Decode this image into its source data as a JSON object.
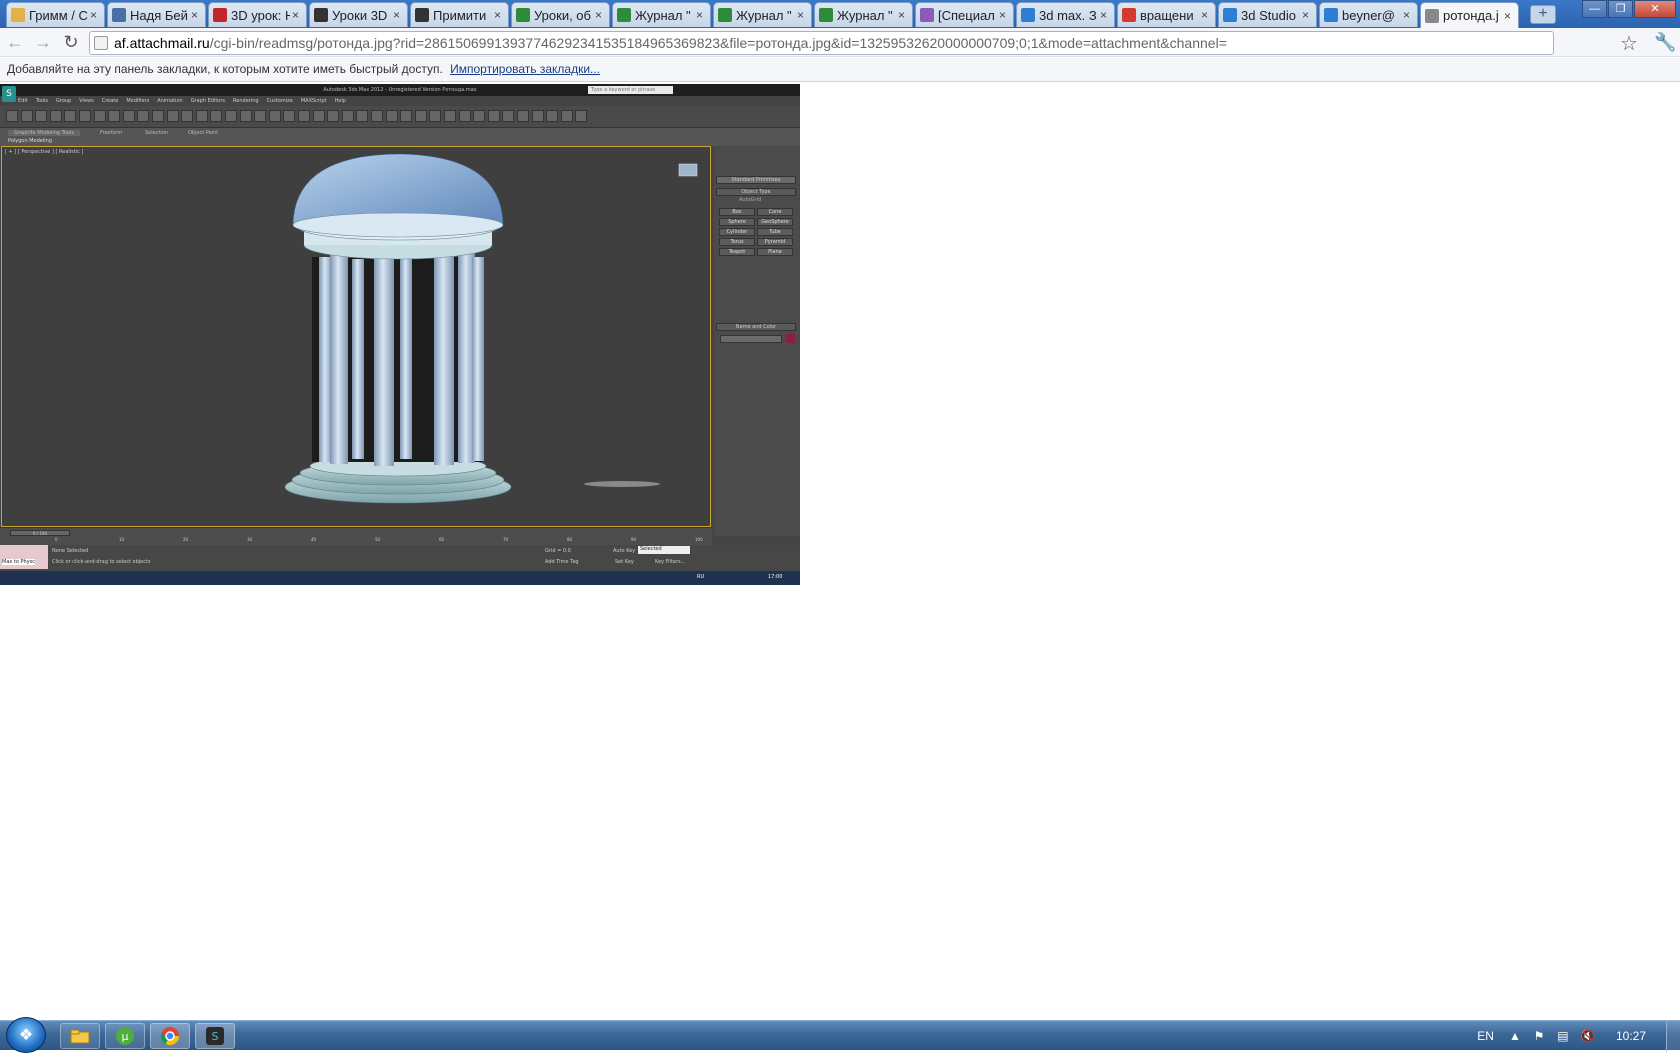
{
  "browser": {
    "tabs": [
      {
        "title": "Гримм / С",
        "favicon": "ex-icon",
        "color": "#e4b04a"
      },
      {
        "title": "Надя Бей",
        "favicon": "vk-icon",
        "color": "#4a6ea8"
      },
      {
        "title": "3D урок: Н",
        "favicon": "3d-icon",
        "color": "#c0262d"
      },
      {
        "title": "Уроки 3D",
        "favicon": "s-icon",
        "color": "#333333"
      },
      {
        "title": "Примити",
        "favicon": "s-icon",
        "color": "#333333"
      },
      {
        "title": "Уроки, об",
        "favicon": "doc-icon",
        "color": "#2e8b3a"
      },
      {
        "title": "Журнал \"",
        "favicon": "doc-icon",
        "color": "#2e8b3a"
      },
      {
        "title": "Журнал \"",
        "favicon": "doc-icon",
        "color": "#2e8b3a"
      },
      {
        "title": "Журнал \"",
        "favicon": "doc-icon",
        "color": "#2e8b3a"
      },
      {
        "title": "[Специал",
        "favicon": "forum-icon",
        "color": "#8a5bb8"
      },
      {
        "title": "3d max. З",
        "favicon": "check-icon",
        "color": "#2e7fd1"
      },
      {
        "title": "вращени",
        "favicon": "yandex-icon",
        "color": "#d43a2f"
      },
      {
        "title": "3d Studio",
        "favicon": "check-icon",
        "color": "#2e7fd1"
      },
      {
        "title": "beyner@",
        "favicon": "mail-icon",
        "color": "#2e7fd1"
      },
      {
        "title": "ротонда.j",
        "favicon": "page-icon",
        "color": "#888888",
        "active": true
      }
    ],
    "new_tab": "+",
    "url_host": "af.attachmail.ru",
    "url_path": "/cgi-bin/readmsg/ротонда.jpg?rid=28615069913937746292341535184965369823&file=ротонда.jpg&id=13259532620000000709;0;1&mode=attachment&channel=",
    "bookmarks_text": "Добавляйте на эту панель закладки, к которым хотите иметь быстрый доступ.",
    "bookmarks_link": "Импортировать закладки..."
  },
  "image": {
    "title": "Autodesk 3ds Max  2012  -  Unregistered Version   Ротонда.max",
    "search_placeholder": "Type a keyword or phrase",
    "menu": [
      "Edit",
      "Tools",
      "Group",
      "Views",
      "Create",
      "Modifiers",
      "Animation",
      "Graph Editors",
      "Rendering",
      "Customize",
      "MAXScript",
      "Help"
    ],
    "ribbon_tabs": [
      "Graphite Modeling Tools",
      "Freeform",
      "Selection",
      "Object Paint"
    ],
    "ribbon_sub": "Polygon Modeling",
    "viewport_label": "[ + ] [ Perspective ] [ Realistic ]",
    "dropdown": "Standard Primitives",
    "rollout_object_type": "Object Type",
    "autogrid": "AutoGrid",
    "primitives": [
      "Box",
      "Cone",
      "Sphere",
      "GeoSphere",
      "Cylinder",
      "Tube",
      "Torus",
      "Pyramid",
      "Teapot",
      "Plane"
    ],
    "rollout_name_color": "Name and Color",
    "time_slider": "0 / 100",
    "ticks": [
      "0",
      "10",
      "20",
      "30",
      "40",
      "50",
      "60",
      "70",
      "80",
      "90",
      "100"
    ],
    "status_none": "None Selected",
    "status_hint": "Click or click-and-drag to select objects",
    "grid": "Grid = 0,0",
    "autokey": "Auto Key",
    "selected": "Selected",
    "setkey": "Set Key",
    "keyfilters": "Key Filters...",
    "addtimetag": "Add Time Tag",
    "welcome": "Max to Physc",
    "lang": "RU",
    "clock": "17:00"
  },
  "taskbar": {
    "apps": [
      "explorer-icon",
      "utorrent-icon",
      "chrome-icon",
      "3dsmax-icon"
    ],
    "language": "EN",
    "clock": "10:27"
  }
}
